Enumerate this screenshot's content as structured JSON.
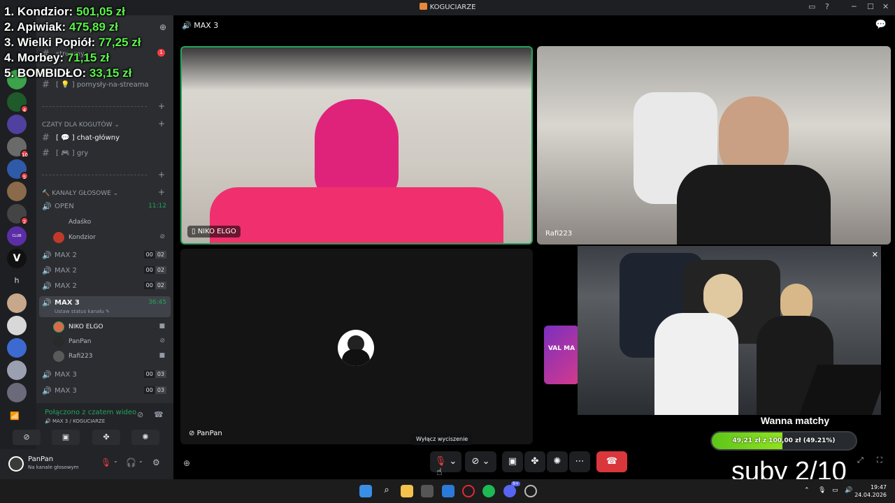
{
  "window": {
    "title": "KOGUCIARZE"
  },
  "donations": [
    {
      "rank": "1. Kondzior:",
      "amount": "501,05 zł"
    },
    {
      "rank": "2. Apiwiak:",
      "amount": "475,89 zł"
    },
    {
      "rank": "3. Wielki Popiół:",
      "amount": "77,25 zł"
    },
    {
      "rank": "4. Morbey:",
      "amount": "71,15 zł"
    },
    {
      "rank": "5. BOMBIDŁO:",
      "amount": "33,15 zł"
    }
  ],
  "rail": {
    "letter": "h",
    "badges": [
      "1",
      "1",
      "4",
      "10",
      "5",
      "2"
    ],
    "club_label": "CLUB FRIDAY"
  },
  "sidebar": {
    "top_badge": "1",
    "channels_top": [
      {
        "emoji": "💡",
        "name": "pomysły-na-streama"
      }
    ],
    "streamy_label": "streamy",
    "cat_chats": "CZATY DLA KOGUTÓW",
    "chat_channels": [
      {
        "emoji": "💬",
        "name": "chat-główny"
      },
      {
        "emoji": "🎮",
        "name": "gry"
      }
    ],
    "cat_voice": "KANAŁY GŁOSOWE",
    "voice_open": {
      "name": "OPEN",
      "timer": "11:12"
    },
    "open_members": [
      {
        "name": "Adaśko"
      },
      {
        "name": "Kondzior"
      }
    ],
    "voice_channels_a": [
      {
        "name": "MAX 2",
        "a": "00",
        "b": "02"
      },
      {
        "name": "MAX 2",
        "a": "00",
        "b": "02"
      },
      {
        "name": "MAX 2",
        "a": "00",
        "b": "02"
      }
    ],
    "voice_selected": {
      "name": "MAX 3",
      "timer": "36:45",
      "status": "Ustaw status kanału"
    },
    "max3_members": [
      {
        "name": "NIKO ELGO"
      },
      {
        "name": "PanPan"
      },
      {
        "name": "Rafi223"
      }
    ],
    "voice_channels_b": [
      {
        "name": "MAX 3",
        "a": "00",
        "b": "03"
      },
      {
        "name": "MAX 3",
        "a": "00",
        "b": "03"
      }
    ]
  },
  "connection": {
    "status": "Połączono z czatem wideo",
    "location": "MAX 3 / KOGUCIARZE"
  },
  "user": {
    "name": "PanPan",
    "status": "Na kanale głosowym"
  },
  "stage": {
    "channel": "MAX 3",
    "tiles": [
      {
        "label": "NIKO ELGO"
      },
      {
        "label": "Rafi223"
      },
      {
        "label": "PanPan"
      }
    ],
    "tooltip": "Wyłącz wyciszenie"
  },
  "overlay": {
    "goal_title": "Wanna matchy",
    "goal_text": "49,21 zł z 100,00 zł (49.21%)",
    "goal_progress": 0.4921,
    "subs": "suby 2/10",
    "badge_text": "VAL MA"
  },
  "taskbar": {
    "time": "19:47",
    "date": "24.04.2026",
    "discord_badge": "9+"
  },
  "colors": {
    "accent_green": "#23a55a",
    "hangup_red": "#da373c",
    "donation_green": "#5cf24c"
  }
}
